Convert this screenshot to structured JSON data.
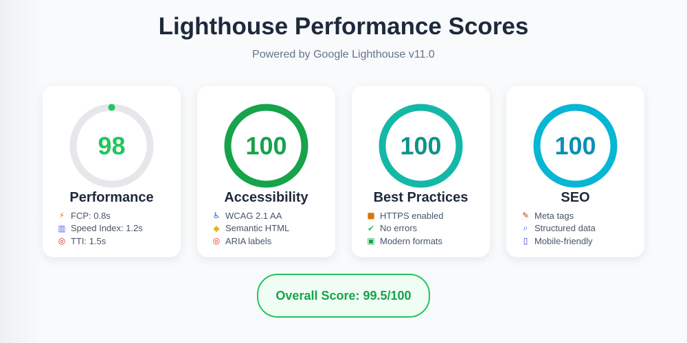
{
  "header": {
    "title": "Lighthouse Performance Scores",
    "subtitle": "Powered by Google Lighthouse v11.0"
  },
  "cards": [
    {
      "label": "Performance",
      "score": "98",
      "score_value": 98,
      "score_color": "#22c55e",
      "ring_color": "#e5e7eb",
      "features": [
        {
          "icon": "lightning-icon",
          "text": "FCP: 0.8s"
        },
        {
          "icon": "bar-chart-icon",
          "text": "Speed Index: 1.2s"
        },
        {
          "icon": "target-icon",
          "text": "TTI: 1.5s"
        }
      ]
    },
    {
      "label": "Accessibility",
      "score": "100",
      "score_value": 100,
      "score_color": "#16a34a",
      "ring_color": "#16a34a",
      "features": [
        {
          "icon": "wheelchair-icon",
          "text": "WCAG 2.1 AA"
        },
        {
          "icon": "tag-icon",
          "text": "Semantic HTML"
        },
        {
          "icon": "target-icon",
          "text": "ARIA labels"
        }
      ]
    },
    {
      "label": "Best Practices",
      "score": "100",
      "score_value": 100,
      "score_color": "#0d9488",
      "ring_color": "#14b8a6",
      "features": [
        {
          "icon": "lock-icon",
          "text": "HTTPS enabled"
        },
        {
          "icon": "check-icon",
          "text": "No errors"
        },
        {
          "icon": "image-icon",
          "text": "Modern formats"
        }
      ]
    },
    {
      "label": "SEO",
      "score": "100",
      "score_value": 100,
      "score_color": "#0891b2",
      "ring_color": "#06b6d4",
      "features": [
        {
          "icon": "memo-icon",
          "text": "Meta tags"
        },
        {
          "icon": "search-icon",
          "text": "Structured data"
        },
        {
          "icon": "mobile-icon",
          "text": "Mobile-friendly"
        }
      ]
    }
  ],
  "overall": {
    "text": "Overall Score: 99.5/100"
  },
  "colors": {
    "background": "#f8fafc",
    "overall_border": "#22c55e",
    "overall_text": "#16a34a"
  }
}
